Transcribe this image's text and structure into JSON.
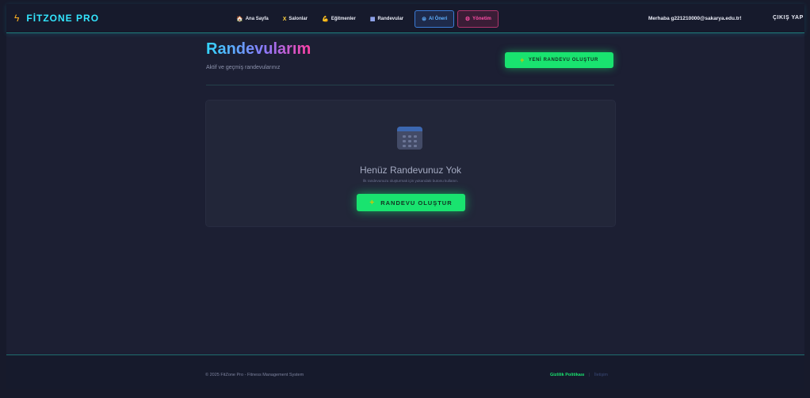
{
  "brand": {
    "icon": "lightning-icon",
    "name": "FİTZONE PRO"
  },
  "nav": {
    "items": [
      {
        "icon": "home-icon",
        "glyph": "🏠",
        "label": "Ana Sayfa"
      },
      {
        "icon": "x-icon",
        "glyph": "X",
        "label": "Salonlar"
      },
      {
        "icon": "muscle-icon",
        "glyph": "💪",
        "label": "Eğitmenler"
      },
      {
        "icon": "calendar-icon",
        "glyph": "▦",
        "label": "Randevular"
      }
    ],
    "ai": {
      "icon": "robot-icon",
      "glyph": "⊜",
      "label": "AI Öneri"
    },
    "admin": {
      "icon": "gear-icon",
      "glyph": "⚙",
      "label": "Yönetim"
    },
    "greeting": "Merhaba g221210000@sakarya.edu.tr!",
    "logout": "ÇIKIŞ YAP"
  },
  "page": {
    "title": "Randevularım",
    "subtitle": "Aktif ve geçmiş randevularınız",
    "new_button": "YENİ RANDEVU OLUŞTUR",
    "plus_glyph": "+"
  },
  "empty_state": {
    "icon": "calendar-icon",
    "title": "Henüz Randevunuz Yok",
    "description": "İlk randevunuzu oluşturmak için yukarıdaki butonu kullanın.",
    "button": "RANDEVU OLUŞTUR"
  },
  "footer": {
    "copyright": "© 2025 FitZone Pro - Fitness Management System",
    "privacy": "Gizlilik Politikası",
    "separator": "|",
    "contact": "İletişim"
  },
  "colors": {
    "accent_green": "#19e36f",
    "brand_cyan": "#33e6ff",
    "background": "#1c1f33",
    "admin_pink": "#ff4da6",
    "ai_blue": "#5fb0ff"
  }
}
